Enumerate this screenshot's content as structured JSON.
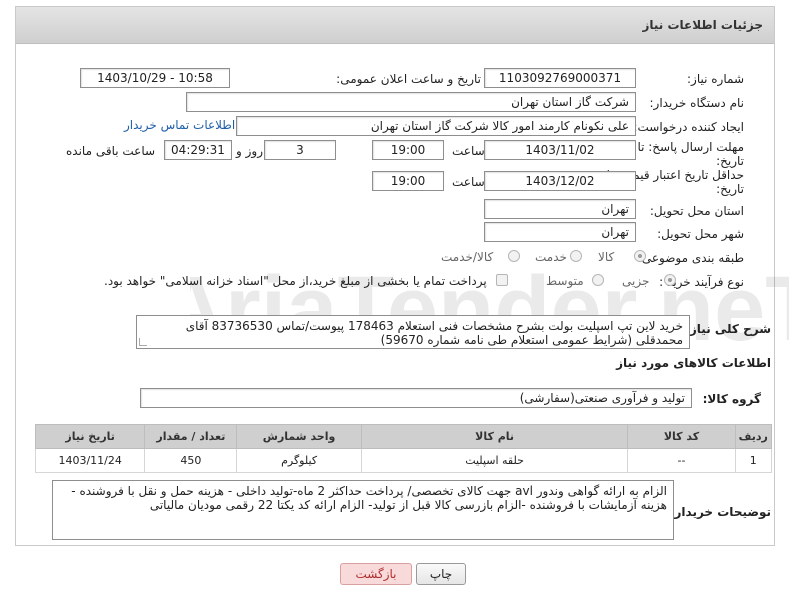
{
  "header": {
    "title": "جزئیات اطلاعات نیاز"
  },
  "fields": {
    "need_number_label": "شماره نیاز:",
    "need_number": "1103092769000371",
    "announce_label": "تاریخ و ساعت اعلان عمومی:",
    "announce_value": "1403/10/29 - 10:58",
    "buyer_org_label": "نام دستگاه خریدار:",
    "buyer_org": "شرکت گاز استان تهران",
    "requester_label": "ایجاد کننده درخواست:",
    "requester": "علی نکونام کارمند امور کالا شرکت گاز استان تهران",
    "contact_link": "اطلاعات تماس خریدار",
    "deadline_label_1": "مهلت ارسال پاسخ: تا",
    "deadline_label_2": "تاریخ:",
    "deadline_date": "1403/11/02",
    "time_label": "ساعت",
    "deadline_time": "19:00",
    "days_value": "3",
    "days_label": "روز و",
    "remaining_time": "04:29:31",
    "remaining_label": "ساعت باقی مانده",
    "validity_label_1": "حداقل تاریخ اعتبار قیمت: تا",
    "validity_label_2": "تاریخ:",
    "validity_date": "1403/12/02",
    "validity_time": "19:00",
    "province_label": "استان محل تحویل:",
    "province": "تهران",
    "city_label": "شهر محل تحویل:",
    "city": "تهران",
    "category_label": "طبقه بندی موضوعی:",
    "category_options": [
      "کالا",
      "خدمت",
      "کالا/خدمت"
    ],
    "process_label": "نوع فرآیند خرید :",
    "process_options": [
      "جزیی",
      "متوسط"
    ],
    "process_note": "پرداخت تمام یا بخشی از مبلغ خرید،از محل \"اسناد خزانه اسلامی\" خواهد بود."
  },
  "description": {
    "label": "شرح کلی نیاز:",
    "text": "خرید لاین تپ اسپلیت بولت بشرح مشخصات فنی استعلام 178463 پیوست/تماس 83736530 آقای محمدقلی (شرایط عمومی استعلام طی نامه شماره 59670)"
  },
  "goods_section": {
    "title": "اطلاعات کالاهای مورد نیاز",
    "group_label": "گروه کالا:",
    "group_value": "تولید و فرآوری صنعتی(سفارشی)"
  },
  "table": {
    "headers": [
      "ردیف",
      "کد کالا",
      "نام کالا",
      "واحد شمارش",
      "تعداد / مقدار",
      "تاریخ نیاز"
    ],
    "rows": [
      [
        "1",
        "--",
        "حلقه اسپلیت",
        "کیلوگرم",
        "450",
        "1403/11/24"
      ]
    ]
  },
  "buyer_notes": {
    "label": "توضیحات خریدار:",
    "text": "الزام به ارائه گواهی وندور avl جهت کالای تخصصی/ پرداخت حداکثر 2 ماه-تولید داخلی - هزینه حمل و نقل با فروشنده - هزینه آزمایشات با فروشنده -الزام بازرسی کالا قبل از تولید- الزام ارائه کد یکتا 22 رقمی مودیان مالیاتی"
  },
  "buttons": {
    "print": "چاپ",
    "back": "بازگشت"
  },
  "watermark_text": "AriaTender.neT",
  "colors": {
    "link": "#1f5fa8",
    "back_button_bg": "#f9dada",
    "header_bg": "#d9d9d9"
  }
}
